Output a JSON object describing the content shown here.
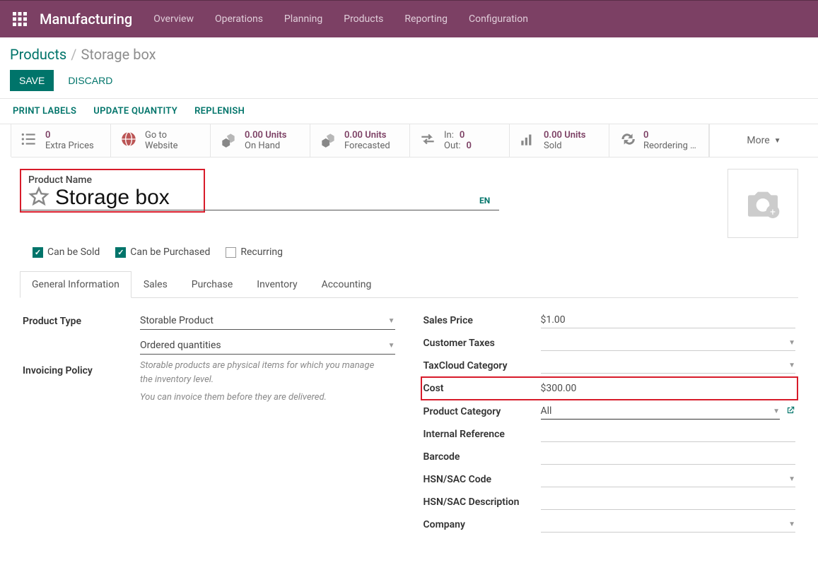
{
  "topbar": {
    "title": "Manufacturing",
    "menu": [
      "Overview",
      "Operations",
      "Planning",
      "Products",
      "Reporting",
      "Configuration"
    ]
  },
  "breadcrumb": {
    "root": "Products",
    "current": "Storage box"
  },
  "actions": {
    "save": "SAVE",
    "discard": "DISCARD"
  },
  "sub_actions": [
    "PRINT LABELS",
    "UPDATE QUANTITY",
    "REPLENISH"
  ],
  "stats": {
    "extra_prices": {
      "value": "0",
      "label": "Extra Prices"
    },
    "website": {
      "line1": "Go to",
      "line2": "Website"
    },
    "on_hand": {
      "value": "0.00 Units",
      "label": "On Hand"
    },
    "forecasted": {
      "value": "0.00 Units",
      "label": "Forecasted"
    },
    "in_out": {
      "in_k": "In:",
      "in_v": "0",
      "out_k": "Out:",
      "out_v": "0"
    },
    "sold": {
      "value": "0.00 Units",
      "label": "Sold"
    },
    "reordering": {
      "value": "0",
      "label": "Reordering …"
    },
    "more": "More"
  },
  "product_name": {
    "label": "Product Name",
    "value": "Storage box",
    "lang": "EN"
  },
  "checks": {
    "sold": {
      "label": "Can be Sold",
      "checked": true
    },
    "purchased": {
      "label": "Can be Purchased",
      "checked": true
    },
    "recurring": {
      "label": "Recurring",
      "checked": false
    }
  },
  "tabs": [
    "General Information",
    "Sales",
    "Purchase",
    "Inventory",
    "Accounting"
  ],
  "left": {
    "product_type": {
      "label": "Product Type",
      "value": "Storable Product"
    },
    "invoicing_policy": {
      "label": "Invoicing Policy",
      "value": "Ordered quantities"
    },
    "help1": "Storable products are physical items for which you manage the inventory level.",
    "help2": "You can invoice them before they are delivered."
  },
  "right": {
    "sales_price": {
      "label": "Sales Price",
      "prefix": "$",
      "value": "1.00"
    },
    "customer_taxes": {
      "label": "Customer Taxes",
      "value": ""
    },
    "taxcloud": {
      "label": "TaxCloud Category",
      "value": ""
    },
    "cost": {
      "label": "Cost",
      "prefix": "$",
      "value": "300.00"
    },
    "category": {
      "label": "Product Category",
      "value": "All"
    },
    "internal_ref": {
      "label": "Internal Reference",
      "value": ""
    },
    "barcode": {
      "label": "Barcode",
      "value": ""
    },
    "hsn": {
      "label": "HSN/SAC Code",
      "value": ""
    },
    "hsn_desc": {
      "label": "HSN/SAC Description",
      "value": ""
    },
    "company": {
      "label": "Company",
      "value": ""
    }
  }
}
